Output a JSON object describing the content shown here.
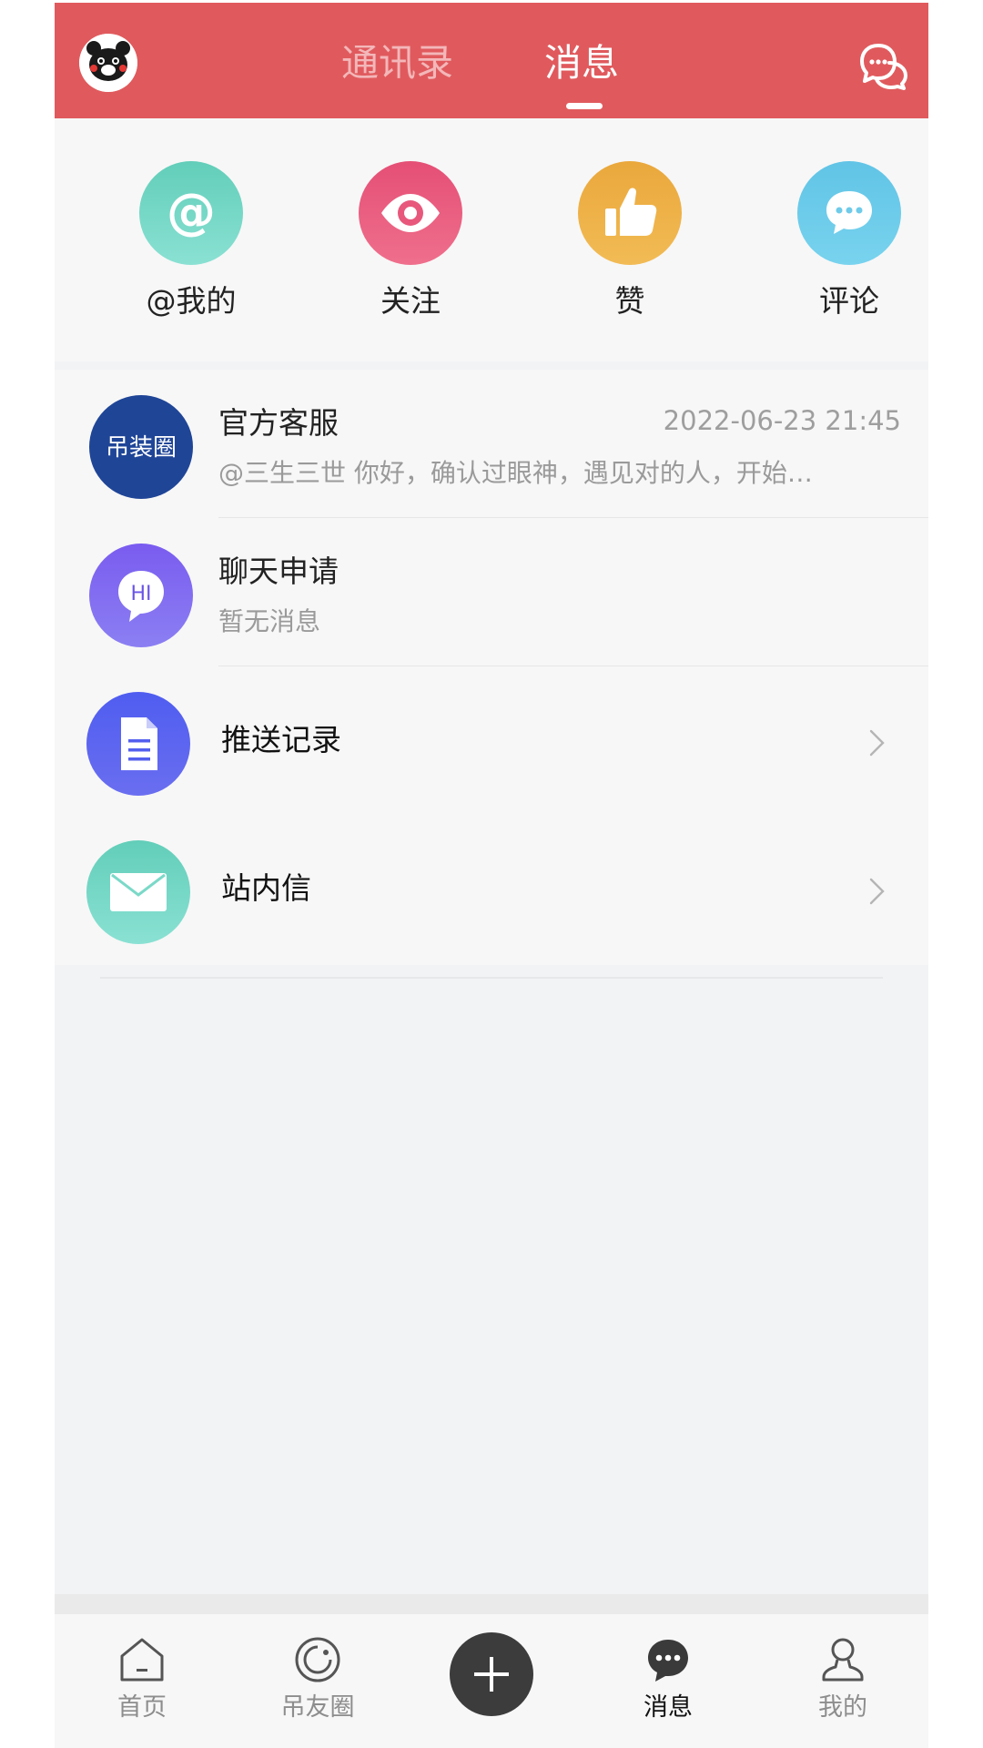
{
  "header": {
    "tabs": [
      {
        "label": "通讯录",
        "active": false
      },
      {
        "label": "消息",
        "active": true
      }
    ],
    "avatar_icon": "kumamon-avatar",
    "chat_icon": "chat-bubbles-icon",
    "background": "#e05a5d"
  },
  "quick_actions": [
    {
      "label": "@我的",
      "icon": "at-icon",
      "color": "#6fd3c2"
    },
    {
      "label": "关注",
      "icon": "eye-icon",
      "color": "#e96182"
    },
    {
      "label": "赞",
      "icon": "thumbs-up-icon",
      "color": "#efb14a"
    },
    {
      "label": "评论",
      "icon": "comment-icon",
      "color": "#6fcbe9"
    }
  ],
  "conversations": [
    {
      "title": "官方客服",
      "subtitle": "@三生三世 你好，确认过眼神，遇见对的人，开始…",
      "time": "2022-06-23 21:45",
      "logo_text": "吊装圈"
    },
    {
      "title": "聊天申请",
      "subtitle": "暂无消息",
      "badge_text": "HI"
    }
  ],
  "entries": [
    {
      "title": "推送记录",
      "icon": "document-icon"
    },
    {
      "title": "站内信",
      "icon": "envelope-icon"
    }
  ],
  "bottom_nav": [
    {
      "label": "首页",
      "icon": "home-icon",
      "active": false
    },
    {
      "label": "吊友圈",
      "icon": "circle-icon",
      "active": false
    },
    {
      "label": "",
      "icon": "plus-icon",
      "active": false
    },
    {
      "label": "消息",
      "icon": "message-icon",
      "active": true
    },
    {
      "label": "我的",
      "icon": "user-icon",
      "active": false
    }
  ]
}
